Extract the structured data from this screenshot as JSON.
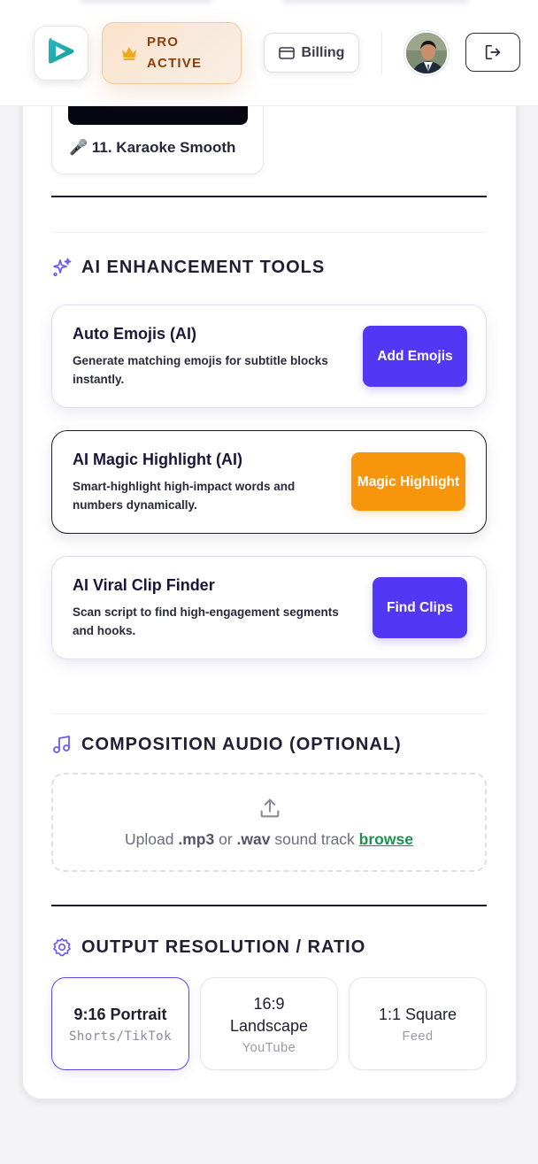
{
  "header": {
    "plan_line1": "PRO",
    "plan_line2": "ACTIVE",
    "billing_label": "Billing",
    "icons": {
      "logo": "play-logo-icon",
      "plan": "crown-icon",
      "billing": "credit-card-icon",
      "logout": "logout-icon"
    }
  },
  "style_preset": {
    "label": "🎤 11. Karaoke Smooth"
  },
  "ai_tools": {
    "title": "AI ENHANCEMENT TOOLS",
    "icon": "sparkles-icon",
    "items": [
      {
        "title": "Auto Emojis (AI)",
        "description": "Generate matching emojis for subtitle blocks instantly.",
        "button": "Add Emojis",
        "button_color": "#5238f5"
      },
      {
        "title": "AI Magic Highlight (AI)",
        "description": "Smart-highlight high-impact words and numbers dynamically.",
        "button": "Magic Highlight",
        "button_color": "#f7950b"
      },
      {
        "title": "AI Viral Clip Finder",
        "description": "Scan script to find high-engagement segments and hooks.",
        "button": "Find Clips",
        "button_color": "#5238f5"
      }
    ]
  },
  "audio": {
    "title": "COMPOSITION AUDIO (OPTIONAL)",
    "icon": "music-note-icon",
    "upload_prefix": "Upload ",
    "upload_ext1": ".mp3",
    "upload_or": " or ",
    "upload_ext2": ".wav",
    "upload_suffix": " sound track ",
    "browse_label": "browse",
    "upload_icon": "upload-icon"
  },
  "output": {
    "title": "OUTPUT RESOLUTION / RATIO",
    "icon": "gear-icon",
    "options": [
      {
        "label": "9:16 Portrait",
        "sub": "Shorts/TikTok",
        "selected": true
      },
      {
        "label": "16:9 Landscape",
        "sub": "YouTube",
        "selected": false
      },
      {
        "label": "1:1 Square",
        "sub": "Feed",
        "selected": false
      }
    ]
  },
  "colors": {
    "accent": "#5238f5",
    "highlight": "#f7950b",
    "link": "#1e9150",
    "plan_text": "#8a3f0c"
  }
}
